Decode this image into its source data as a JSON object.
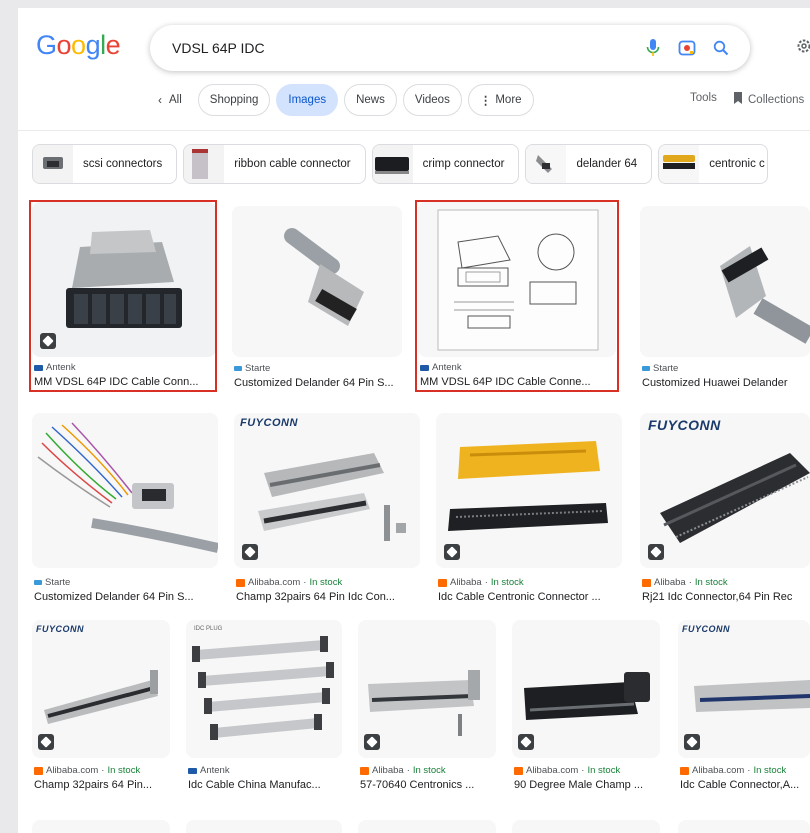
{
  "logo": [
    "G",
    "o",
    "o",
    "g",
    "l",
    "e"
  ],
  "logo_colors": [
    "#4285f4",
    "#ea4335",
    "#fbbc05",
    "#4285f4",
    "#34a853",
    "#ea4335"
  ],
  "search": {
    "query": "VDSL 64P IDC"
  },
  "icons": {
    "mic": "mic-icon",
    "lens": "camera-lens-icon",
    "search": "search-icon",
    "settings": "gear-icon"
  },
  "tabs": {
    "all": "All",
    "shopping": "Shopping",
    "images": "Images",
    "news": "News",
    "videos": "Videos",
    "more": "More",
    "tools": "Tools",
    "collections": "Collections"
  },
  "chips": [
    {
      "label": "scsi connectors"
    },
    {
      "label": "ribbon cable connector"
    },
    {
      "label": "crimp connector"
    },
    {
      "label": "delander 64"
    },
    {
      "label": "centronic c"
    }
  ],
  "results": [
    {
      "source": "Antenk",
      "stock": "",
      "title": "MM VDSL 64P IDC Cable Conn..."
    },
    {
      "source": "Starte",
      "stock": "",
      "title": "Customized Delander 64 Pin S..."
    },
    {
      "source": "Antenk",
      "stock": "",
      "title": "MM VDSL 64P IDC Cable Conne..."
    },
    {
      "source": "Starte",
      "stock": "",
      "title": "Customized Huawei Delander"
    },
    {
      "source": "Starte",
      "stock": "",
      "title": "Customized Delander 64 Pin S..."
    },
    {
      "source": "Alibaba.com",
      "stock": "In stock",
      "title": "Champ 32pairs 64 Pin Idc Con..."
    },
    {
      "source": "Alibaba",
      "stock": "In stock",
      "title": "Idc Cable Centronic Connector ..."
    },
    {
      "source": "Alibaba",
      "stock": "In stock",
      "title": "Rj21 Idc Connector,64 Pin Rec"
    },
    {
      "source": "Alibaba.com",
      "stock": "In stock",
      "title": "Champ 32pairs 64 Pin..."
    },
    {
      "source": "Antenk",
      "stock": "",
      "title": "Idc Cable China Manufac..."
    },
    {
      "source": "Alibaba",
      "stock": "In stock",
      "title": "57-70640 Centronics ..."
    },
    {
      "source": "Alibaba.com",
      "stock": "In stock",
      "title": "90 Degree Male Champ ..."
    },
    {
      "source": "Alibaba.com",
      "stock": "In stock",
      "title": "Idc Cable Connector,A..."
    }
  ],
  "brand_text": "FUYCONN",
  "doc_header": "IDC PLUG",
  "sep": "·",
  "colors": {
    "accent_blue": "#0b57d0",
    "in_stock": "#188038",
    "highlight_red": "#d93025"
  }
}
